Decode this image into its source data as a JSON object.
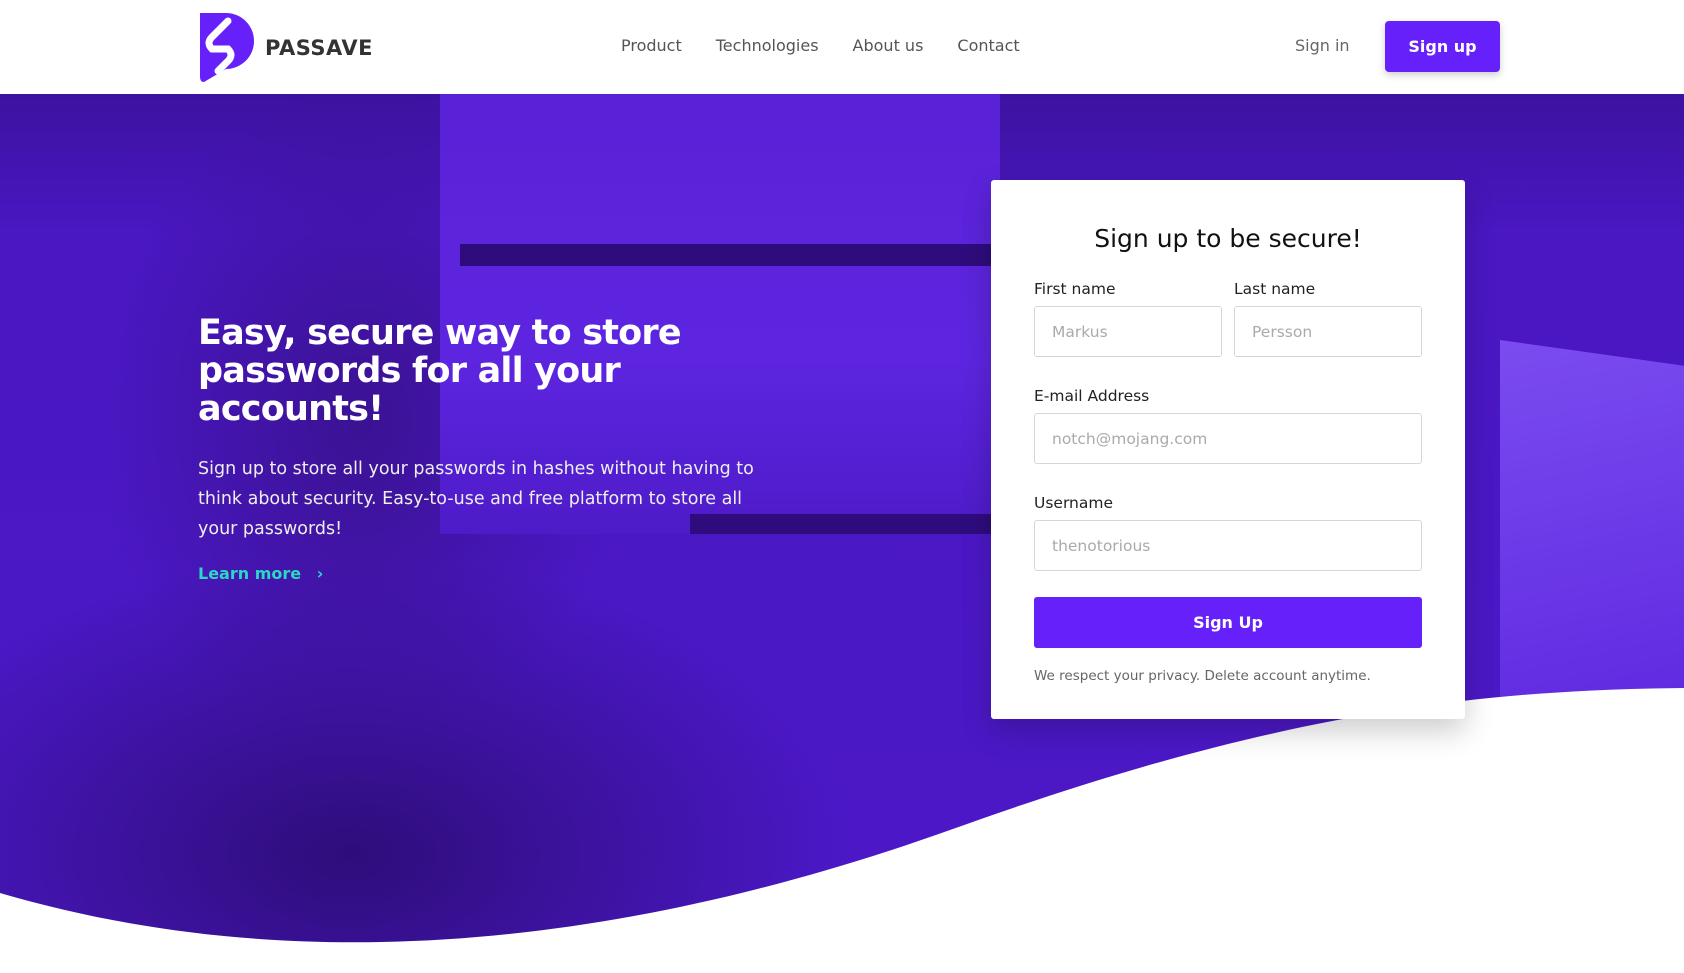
{
  "header": {
    "brand": "PASSAVE",
    "nav": [
      "Product",
      "Technologies",
      "About us",
      "Contact"
    ],
    "sign_in": "Sign in",
    "sign_up": "Sign up"
  },
  "hero": {
    "title": "Easy, secure way to store passwords for all your accounts!",
    "description": "Sign up to store all your passwords in hashes without having to think about security. Easy-to-use and free platform to store all your passwords!",
    "learn_more": "Learn more",
    "learn_more_icon": "chevron-right-icon"
  },
  "form": {
    "title": "Sign up to be secure!",
    "first_name_label": "First name",
    "first_name_placeholder": "Markus",
    "last_name_label": "Last name",
    "last_name_placeholder": "Persson",
    "email_label": "E-mail Address",
    "email_placeholder": "notch@mojang.com",
    "username_label": "Username",
    "username_placeholder": "thenotorious",
    "submit": "Sign Up",
    "privacy": "We respect your privacy. Delete account anytime."
  },
  "colors": {
    "primary": "#6621fb",
    "accent": "#2ad8c4",
    "hero": "#4c18c8"
  }
}
